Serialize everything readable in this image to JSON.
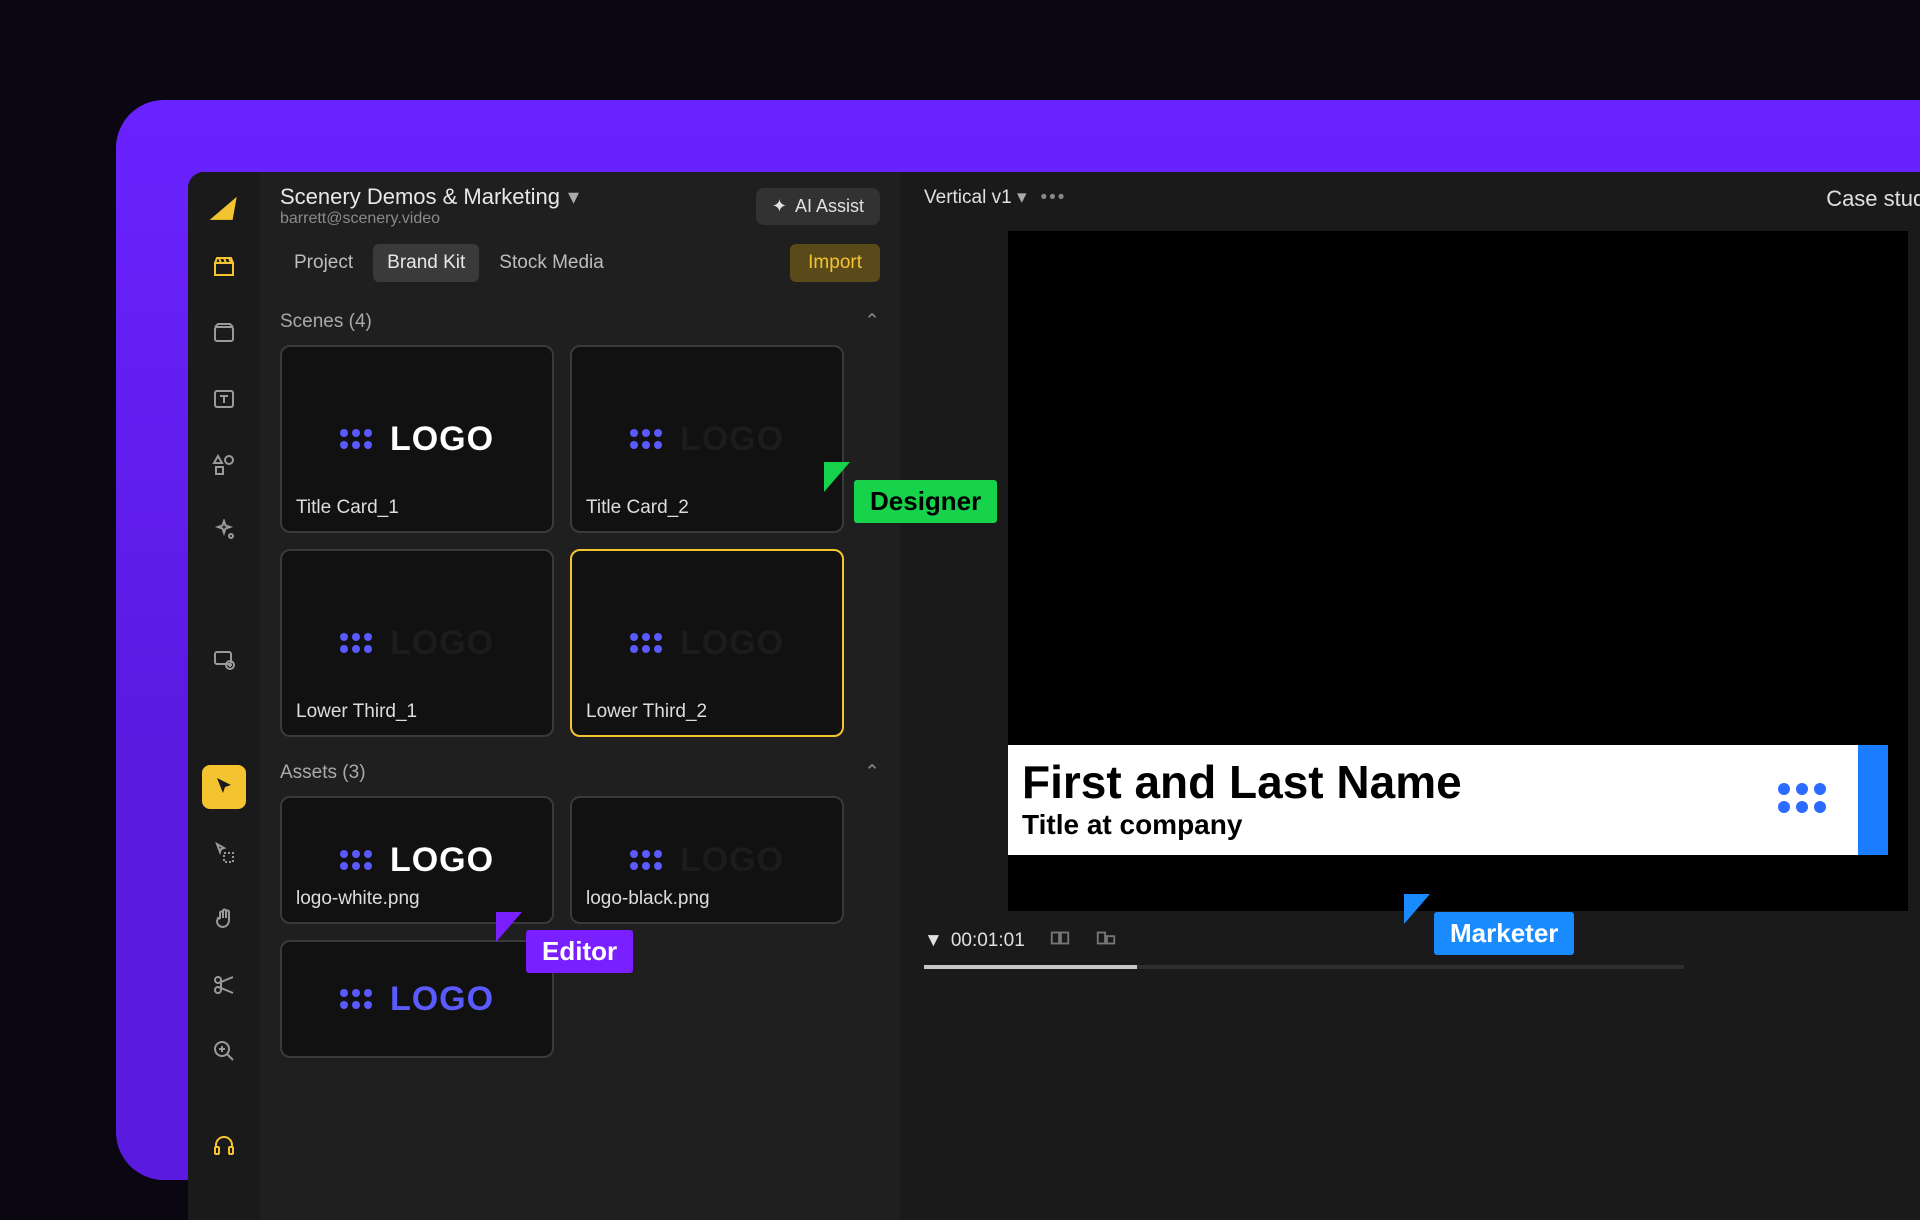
{
  "header": {
    "project_name": "Scenery Demos & Marketing",
    "user_email": "barrett@scenery.video",
    "ai_assist_label": "AI Assist",
    "right_title": "Case study video"
  },
  "tabs": {
    "items": [
      "Project",
      "Brand Kit",
      "Stock Media"
    ],
    "active_index": 1,
    "import_label": "Import"
  },
  "scenes": {
    "heading": "Scenes (4)",
    "items": [
      {
        "label": "Title Card_1",
        "logo_style": "white"
      },
      {
        "label": "Title Card_2",
        "logo_style": "dark"
      },
      {
        "label": "Lower Third_1",
        "logo_style": "dark"
      },
      {
        "label": "Lower Third_2",
        "logo_style": "dark",
        "selected": true
      }
    ]
  },
  "assets": {
    "heading": "Assets (3)",
    "items": [
      {
        "label": "logo-white.png",
        "logo_style": "white"
      },
      {
        "label": "logo-black.png",
        "logo_style": "dark"
      },
      {
        "label": "",
        "logo_style": "blue"
      }
    ]
  },
  "viewer": {
    "variant_label": "Vertical v1",
    "lower_third_name": "First and Last Name",
    "lower_third_title": "Title at company"
  },
  "playbar": {
    "timecode": "00:01:01"
  },
  "collaborators": {
    "designer": "Designer",
    "editor": "Editor",
    "marketer": "Marketer"
  }
}
